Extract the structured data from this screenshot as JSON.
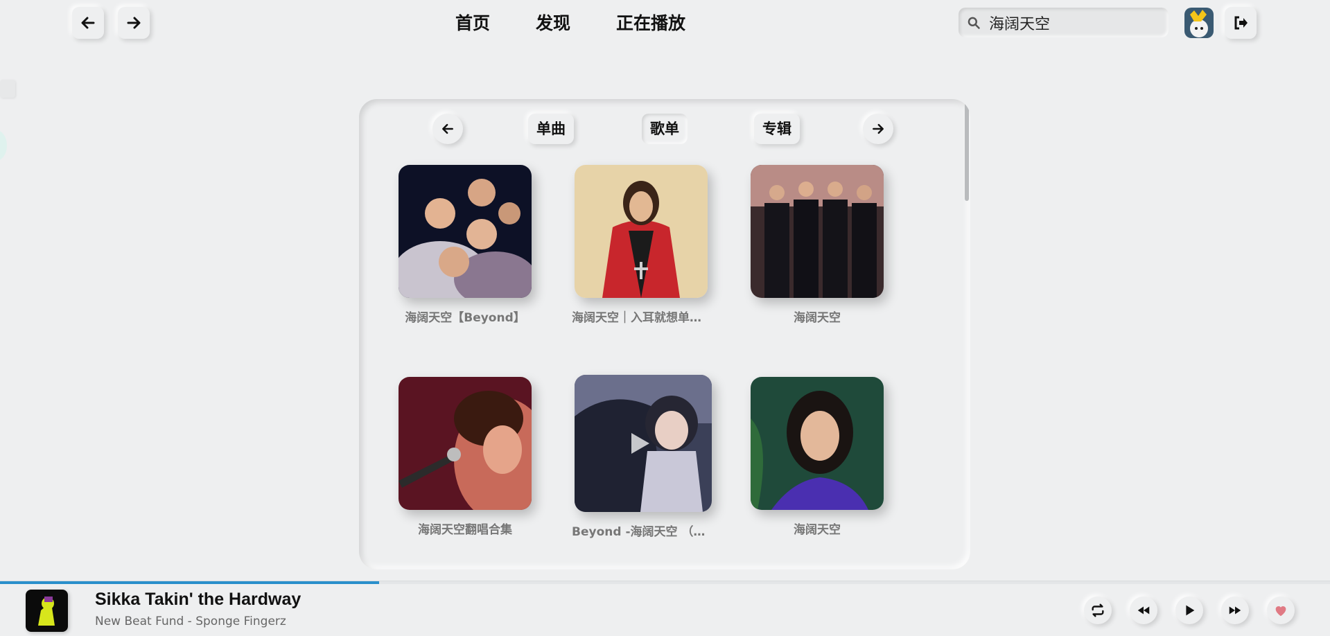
{
  "nav": {
    "back_icon": "arrow-left-icon",
    "forward_icon": "arrow-right-icon",
    "links": [
      "首页",
      "发现",
      "正在播放"
    ]
  },
  "search": {
    "value": "海阔天空",
    "icon": "search-icon"
  },
  "user": {
    "avatar": "user-avatar",
    "logout_icon": "logout-icon"
  },
  "results": {
    "tabs": [
      "单曲",
      "歌单",
      "专辑"
    ],
    "active_tab": "歌单",
    "playlists": [
      {
        "title": "海阔天空【Beyond】"
      },
      {
        "title": "海阔天空｜入耳就想单曲循环"
      },
      {
        "title": "海阔天空"
      },
      {
        "title": "海阔天空翻唱合集"
      },
      {
        "title": "Beyond -海阔天空 （D..."
      },
      {
        "title": "海阔天空"
      }
    ]
  },
  "player": {
    "title": "Sikka Takin' the Hardway",
    "artist": "New Beat Fund - Sponge Fingerz",
    "progress": 0.285,
    "controls": [
      "repeat-icon",
      "rewind-icon",
      "play-icon",
      "fast-forward-icon",
      "heart-icon"
    ],
    "colors": {
      "accent": "#2a8fcb",
      "heart": "#e07a84"
    }
  }
}
